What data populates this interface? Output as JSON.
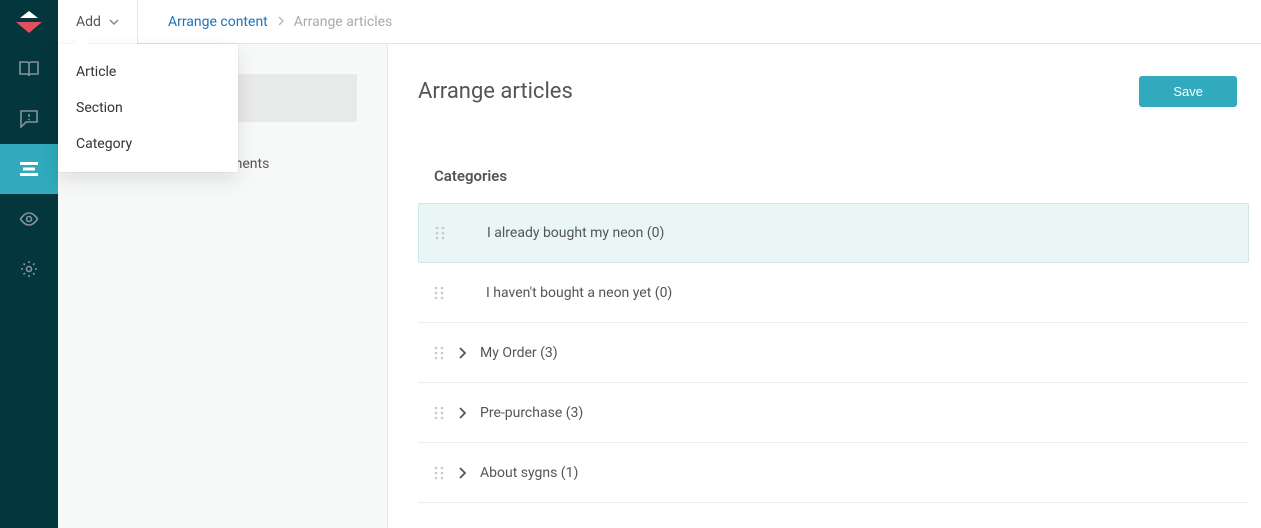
{
  "topbar": {
    "add_label": "Add",
    "breadcrumb": {
      "parent": "Arrange content",
      "current": "Arrange articles"
    }
  },
  "dropdown": {
    "items": [
      {
        "label": "Article"
      },
      {
        "label": "Section"
      },
      {
        "label": "Category"
      }
    ]
  },
  "sidebar": {
    "user_segments_label": "User segments"
  },
  "main": {
    "title": "Arrange articles",
    "save_label": "Save",
    "section_heading": "Categories",
    "categories": [
      {
        "label": "I already bought my neon (0)",
        "expandable": false,
        "highlight": true
      },
      {
        "label": "I haven't bought a neon yet (0)",
        "expandable": false,
        "highlight": false
      },
      {
        "label": "My Order (3)",
        "expandable": true,
        "highlight": false
      },
      {
        "label": "Pre-purchase (3)",
        "expandable": true,
        "highlight": false
      },
      {
        "label": "About sygns (1)",
        "expandable": true,
        "highlight": false
      }
    ]
  }
}
